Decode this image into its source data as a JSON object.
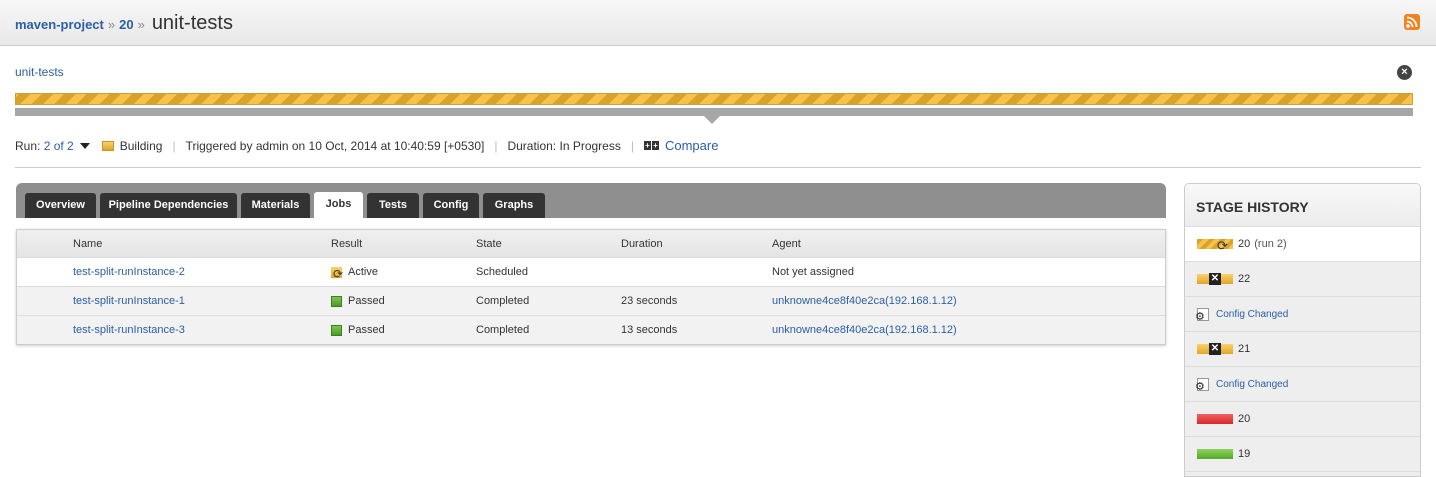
{
  "breadcrumb": {
    "pipeline": "maven-project",
    "sep1": "»",
    "counter": "20",
    "sep2": "»",
    "stage": "unit-tests"
  },
  "stage_link": "unit-tests",
  "close_symbol": "×",
  "progress": {
    "status": "building",
    "color": "#f6c24a"
  },
  "run_info": {
    "run_label": "Run:",
    "run_value": "2 of 2",
    "status": "Building",
    "triggered": "Triggered by admin on 10 Oct, 2014 at 10:40:59 [+0530]",
    "duration": "Duration: In Progress",
    "compare": "Compare",
    "separator": "|"
  },
  "tabs": [
    {
      "label": "Overview",
      "active": false
    },
    {
      "label": "Pipeline Dependencies",
      "active": false
    },
    {
      "label": "Materials",
      "active": false
    },
    {
      "label": "Jobs",
      "active": true
    },
    {
      "label": "Tests",
      "active": false
    },
    {
      "label": "Config",
      "active": false
    },
    {
      "label": "Graphs",
      "active": false
    }
  ],
  "jobs": {
    "headers": [
      "Name",
      "Result",
      "State",
      "Duration",
      "Agent"
    ],
    "rows": [
      {
        "name": "test-split-runInstance-2",
        "result": "Active",
        "result_icon": "active-icon",
        "state": "Scheduled",
        "duration": "",
        "agent": "Not yet assigned",
        "agent_link": false
      },
      {
        "name": "test-split-runInstance-1",
        "result": "Passed",
        "result_icon": "passed-icon",
        "state": "Completed",
        "duration": "23 seconds",
        "agent": "unknowne4ce8f40e2ca(192.168.1.12)",
        "agent_link": true
      },
      {
        "name": "test-split-runInstance-3",
        "result": "Passed",
        "result_icon": "passed-icon",
        "state": "Completed",
        "duration": "13 seconds",
        "agent": "unknowne4ce8f40e2ca(192.168.1.12)",
        "agent_link": true
      }
    ]
  },
  "history": {
    "title": "STAGE HISTORY",
    "items": [
      {
        "type": "run",
        "status": "building",
        "label": "20",
        "sub": "(run 2)"
      },
      {
        "type": "run",
        "status": "cancelled",
        "label": "22",
        "sub": ""
      },
      {
        "type": "config",
        "label": "Config Changed"
      },
      {
        "type": "run",
        "status": "cancelled",
        "label": "21",
        "sub": ""
      },
      {
        "type": "config",
        "label": "Config Changed"
      },
      {
        "type": "run",
        "status": "failed",
        "label": "20",
        "sub": ""
      },
      {
        "type": "run",
        "status": "passed",
        "label": "19",
        "sub": ""
      }
    ]
  },
  "colors": {
    "link": "#2b5ea7",
    "building": "#f6c24a",
    "passed": "#56a82c",
    "failed": "#d42a2a",
    "rss": "#f58220"
  }
}
